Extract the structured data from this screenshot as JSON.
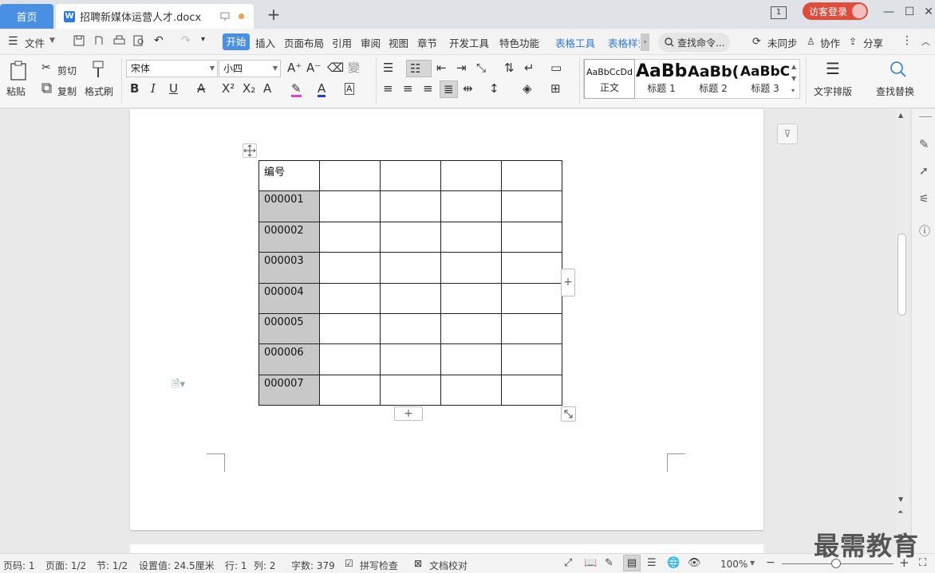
{
  "tabs": {
    "home": "首页",
    "doc_name": "招聘新媒体运营人才.docx",
    "doc_icon_letter": "W"
  },
  "window": {
    "page_count_badge": "1",
    "login_label": "访客登录"
  },
  "menu": {
    "file": "文件",
    "items": [
      "开始",
      "插入",
      "页面布局",
      "引用",
      "审阅",
      "视图",
      "章节",
      "开发工具",
      "特色功能",
      "表格工具",
      "表格样式"
    ],
    "search_placeholder": "查找命令...",
    "sync": "未同步",
    "collab": "协作",
    "share": "分享"
  },
  "ribbon": {
    "paste": "粘贴",
    "cut": "剪切",
    "copy": "复制",
    "format_painter": "格式刷",
    "font_name": "宋体",
    "font_size": "小四",
    "styles": [
      {
        "preview": "AaBbCcDd",
        "label": "正文"
      },
      {
        "preview": "AaBb",
        "label": "标题 1"
      },
      {
        "preview": "AaBb(",
        "label": "标题 2"
      },
      {
        "preview": "AaBbC",
        "label": "标题 3"
      }
    ],
    "text_layout": "文字排版",
    "find_replace": "查找替换"
  },
  "table": {
    "header": "编号",
    "rows": [
      "000001",
      "000002",
      "000003",
      "000004",
      "000005",
      "000006",
      "000007"
    ]
  },
  "status": {
    "page_num": "页码: 1",
    "pages": "页面: 1/2",
    "section": "节: 1/2",
    "setting": "设置值: 24.5厘米",
    "line": "行: 1",
    "col": "列: 2",
    "word_count": "字数: 379",
    "spell": "拼写检查",
    "proof": "文档校对",
    "zoom": "100%"
  },
  "watermark": "最需教育",
  "colors": {
    "accent": "#4a90e2",
    "login": "#e04c3c",
    "table_grey": "#c8c8c8"
  }
}
